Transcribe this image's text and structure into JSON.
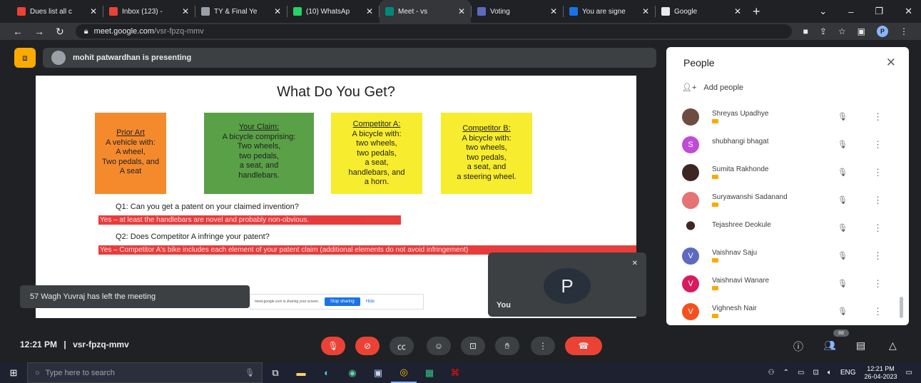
{
  "browser": {
    "tabs": [
      {
        "label": "Dues list all c",
        "icon_color": "#ea4335",
        "icon": "gmail-icon"
      },
      {
        "label": "Inbox (123) -",
        "icon_color": "#ea4335",
        "icon": "gmail-icon"
      },
      {
        "label": "TY & Final Ye",
        "icon_color": "#9aa0a6",
        "icon": "link-icon"
      },
      {
        "label": "(10) WhatsAp",
        "icon_color": "#25d366",
        "icon": "whatsapp-icon"
      },
      {
        "label": "Meet - vs",
        "icon_color": "#00897b",
        "icon": "meet-icon",
        "active": true
      },
      {
        "label": "Voting",
        "icon_color": "#5c6bc0",
        "icon": "forms-icon"
      },
      {
        "label": "You are signe",
        "icon_color": "#1a73e8",
        "icon": "s-icon"
      },
      {
        "label": "Google",
        "icon_color": "#e8eaed",
        "icon": "google-icon"
      }
    ],
    "url_domain": "meet.google.com",
    "url_path": "/vsr-fpzq-mmv",
    "profile_initial": "P"
  },
  "meet": {
    "presenting_text": "mohit patwardhan is presenting",
    "slide": {
      "title": "What Do You Get?",
      "prior_art": {
        "heading": "Prior Art",
        "lines": [
          "A vehicle with:",
          "A wheel,",
          "Two pedals, and",
          "A seat"
        ]
      },
      "your_claim": {
        "heading": "Your Claim:",
        "lines": [
          "A bicycle comprising:",
          "Two wheels,",
          "two pedals,",
          "a seat, and",
          "handlebars."
        ]
      },
      "competitor_a": {
        "heading": "Competitor A:",
        "lines": [
          "A bicycle with:",
          "two wheels,",
          "two pedals,",
          "a seat,",
          "handlebars, and",
          "a horn."
        ]
      },
      "competitor_b": {
        "heading": "Competitor B:",
        "lines": [
          "A bicycle with:",
          "two wheels,",
          "two pedals,",
          "a seat, and",
          "a steering wheel."
        ]
      },
      "q1": "Q1: Can you get a patent on your claimed invention?",
      "a1": "Yes – at least the handlebars are novel and probably non-obvious.",
      "q2": "Q2: Does Competitor A infringe your patent?",
      "a2": "Yes – Competitor A's bike includes each element of your patent claim (additional elements do not avoid infringement)",
      "sharing_text": "meet.google.com is sharing your screen.",
      "stop_sharing": "Stop sharing",
      "hide": "Hide"
    },
    "toast": "57 Wagh Yuvraj has left the meeting",
    "self": {
      "initial": "P",
      "name": "You"
    },
    "people_panel": {
      "title": "People",
      "add_people": "Add people",
      "participants": [
        {
          "name": "Shreyas Upadhye",
          "avatar_color": "#6d4c41",
          "initial": ""
        },
        {
          "name": "shubhangi bhagat",
          "avatar_color": "#c04bd6",
          "initial": "S"
        },
        {
          "name": "Sumita Rakhonde",
          "avatar_color": "#3e2723",
          "initial": ""
        },
        {
          "name": "Suryawanshi Sadanand",
          "avatar_color": "#e57373",
          "initial": ""
        },
        {
          "name": "Tejashree Deokule",
          "avatar_color": "#ffffff",
          "initial": ""
        },
        {
          "name": "Vaishnav Saju",
          "avatar_color": "#5c6bc0",
          "initial": "V"
        },
        {
          "name": "Vaishnavi Wanare",
          "avatar_color": "#d81b60",
          "initial": "V"
        },
        {
          "name": "Vighnesh Nair",
          "avatar_color": "#f4511e",
          "initial": "V"
        }
      ]
    },
    "bottom": {
      "time": "12:21 PM",
      "separator": "|",
      "meeting_code": "vsr-fpzq-mmv",
      "people_count": "88"
    }
  },
  "taskbar": {
    "search_placeholder": "Type here to search",
    "language": "ENG",
    "time": "12:21 PM",
    "date": "26-04-2023"
  }
}
